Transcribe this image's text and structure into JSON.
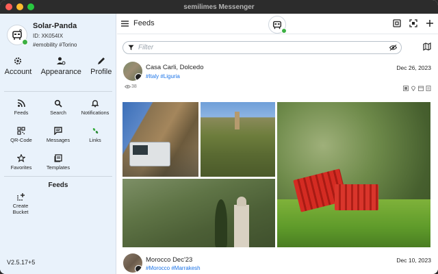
{
  "window": {
    "title": "semilimes Messenger"
  },
  "sidebar": {
    "profile": {
      "name": "Solar-Panda",
      "id": "ID: XK054IX",
      "tags": "#emobility #Torino"
    },
    "account_actions": [
      {
        "label": "Account",
        "icon": "gear-icon"
      },
      {
        "label": "Appearance",
        "icon": "user-settings-icon"
      },
      {
        "label": "Profile",
        "icon": "pencil-icon"
      }
    ],
    "nav": [
      {
        "label": "Feeds",
        "icon": "rss-icon"
      },
      {
        "label": "Search",
        "icon": "search-icon"
      },
      {
        "label": "Notifications",
        "icon": "bell-icon"
      },
      {
        "label": "QR-Code",
        "icon": "qr-code-icon"
      },
      {
        "label": "Messages",
        "icon": "message-icon"
      },
      {
        "label": "Links",
        "icon": "links-icon"
      },
      {
        "label": "Favorites",
        "icon": "star-icon"
      },
      {
        "label": "Templates",
        "icon": "templates-icon"
      }
    ],
    "section_title": "Feeds",
    "create_bucket": {
      "label": "Create\nBucket",
      "icon": "create-bucket-icon"
    },
    "version": "V2.5.17+5"
  },
  "main": {
    "title": "Feeds",
    "filter": {
      "placeholder": "Filter",
      "value": ""
    },
    "posts": [
      {
        "title": "Casa Carli, Dolcedo",
        "tags": "#Italy #Liguria",
        "date": "Dec 26, 2023",
        "views": "38"
      },
      {
        "title": "Morocco Dec'23",
        "tags": "#Morocco #Marrakesh",
        "date": "Dec 10, 2023"
      }
    ]
  },
  "colors": {
    "sidebar_bg": "#e9f2fb",
    "accent_link": "#1a73e8",
    "online": "#3cb043"
  }
}
